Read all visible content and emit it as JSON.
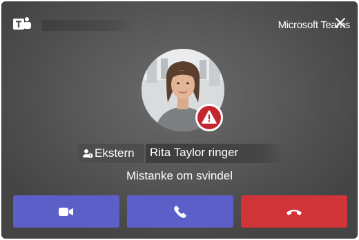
{
  "app": {
    "name": "Microsoft Teams"
  },
  "caller": {
    "external_label": "Ekstern",
    "ringing_text": "Rita Taylor ringer",
    "warning_text": "Mistanke om svindel"
  },
  "icons": {
    "logo": "teams-logo-icon",
    "close": "close-icon",
    "warning": "warning-icon",
    "external": "external-user-icon",
    "video": "video-camera-icon",
    "audio": "phone-icon",
    "decline": "hang-up-icon"
  },
  "colors": {
    "accept": "#5b5fc7",
    "decline": "#d13438",
    "warning": "#c4262e",
    "background": "#565656"
  }
}
